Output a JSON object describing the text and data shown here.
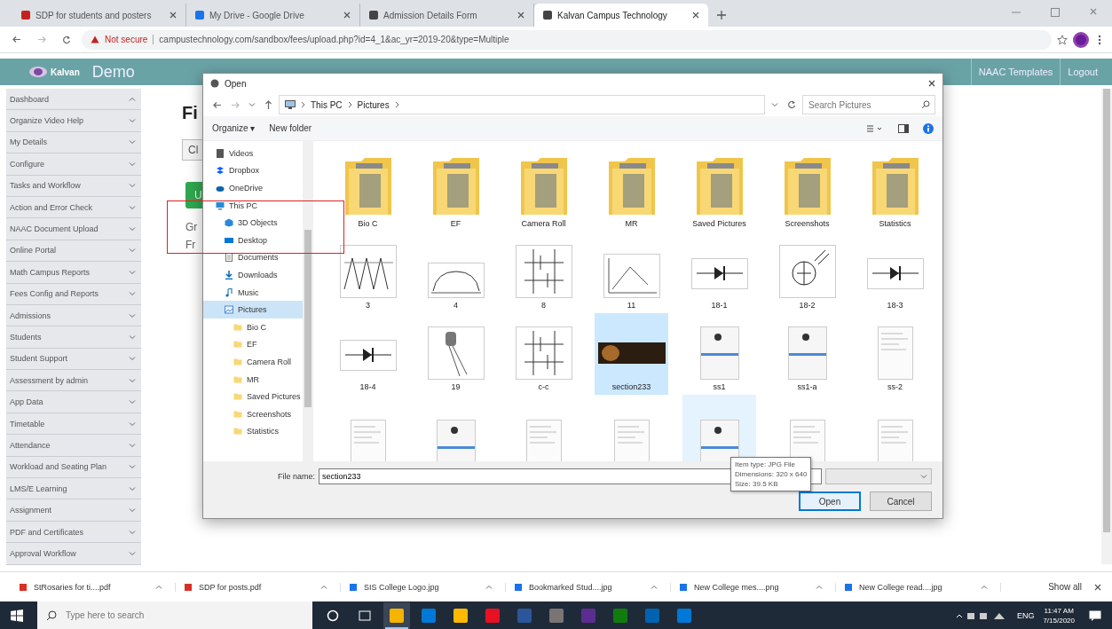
{
  "browser": {
    "tabs": [
      {
        "label": "SDP for students and posters",
        "selected": false,
        "color": "#c5221f"
      },
      {
        "label": "My Drive - Google Drive",
        "selected": false,
        "color": "#1a73e8"
      },
      {
        "label": "Admission Details Form",
        "selected": false,
        "color": "#444444"
      },
      {
        "label": "Kalvan Campus Technology",
        "selected": true,
        "color": "#444444"
      }
    ],
    "security": "Not secure",
    "url": "campustechnology.com/sandbox/fees/upload.php?id=4_1&ac_yr=2019-20&type=Multiple"
  },
  "app": {
    "logo": "Kalvan",
    "title": "Demo",
    "links": [
      "NAAC Templates",
      "Logout"
    ]
  },
  "sidebar": {
    "items": [
      {
        "label": "Dashboard",
        "expanded": true
      },
      {
        "label": "Organize Video Help",
        "expanded": false
      },
      {
        "label": "My Details",
        "expanded": false
      },
      {
        "label": "Configure",
        "expanded": false
      },
      {
        "label": "Tasks and Workflow",
        "expanded": false
      },
      {
        "label": "Action and Error Check",
        "expanded": false
      },
      {
        "label": "NAAC Document Upload",
        "expanded": false
      },
      {
        "label": "Online Portal",
        "expanded": false
      },
      {
        "label": "Math Campus Reports",
        "expanded": false
      },
      {
        "label": "Fees Config and Reports",
        "expanded": false
      },
      {
        "label": "Admissions",
        "expanded": false
      },
      {
        "label": "Students",
        "expanded": false
      },
      {
        "label": "Student Support",
        "expanded": false
      },
      {
        "label": "Assessment by admin",
        "expanded": false
      },
      {
        "label": "App Data",
        "expanded": false
      },
      {
        "label": "Timetable",
        "expanded": false
      },
      {
        "label": "Attendance",
        "expanded": false
      },
      {
        "label": "Workload and Seating Plan",
        "expanded": false
      },
      {
        "label": "LMS/E Learning",
        "expanded": false
      },
      {
        "label": "Assignment",
        "expanded": false
      },
      {
        "label": "PDF and Certificates",
        "expanded": false
      },
      {
        "label": "Approval Workflow",
        "expanded": false
      }
    ]
  },
  "content": {
    "heading": "Fi",
    "button": "Cl",
    "action": "U",
    "lines": [
      "Gr",
      "Fr"
    ]
  },
  "dialog": {
    "title": "Open",
    "path": [
      "This PC",
      "Pictures"
    ],
    "search": {
      "placeholder": "Search Pictures"
    },
    "toolbar": [
      "Organize ▾",
      "New folder"
    ],
    "nav": [
      {
        "label": "Videos",
        "kind": "video",
        "selected": false
      },
      {
        "label": "Dropbox",
        "kind": "dropbox",
        "selected": false
      },
      {
        "label": "OneDrive",
        "kind": "cloud",
        "selected": false
      },
      {
        "label": "This PC",
        "kind": "pc",
        "selected": false,
        "children": [
          {
            "label": "3D Objects",
            "kind": "cube",
            "selected": false
          },
          {
            "label": "Desktop",
            "kind": "desktop",
            "selected": false
          },
          {
            "label": "Documents",
            "kind": "document",
            "selected": false
          },
          {
            "label": "Downloads",
            "kind": "download",
            "selected": false
          },
          {
            "label": "Music",
            "kind": "music",
            "selected": false
          },
          {
            "label": "Pictures",
            "kind": "pictures",
            "selected": true,
            "children": [
              {
                "label": "Bio C",
                "kind": "folder",
                "selected": false
              },
              {
                "label": "EF",
                "kind": "folder",
                "selected": false
              },
              {
                "label": "Camera Roll",
                "kind": "folder",
                "selected": false
              },
              {
                "label": "MR",
                "kind": "folder",
                "selected": false
              },
              {
                "label": "Saved Pictures",
                "kind": "folder",
                "selected": false
              },
              {
                "label": "Screenshots",
                "kind": "folder",
                "selected": false
              },
              {
                "label": "Statistics",
                "kind": "folder",
                "selected": false
              }
            ]
          }
        ]
      }
    ],
    "items": [
      {
        "label": "Bio C",
        "kind": "folder",
        "selected": false,
        "hovered": false
      },
      {
        "label": "EF",
        "kind": "folder",
        "selected": false,
        "hovered": false
      },
      {
        "label": "Camera Roll",
        "kind": "folder",
        "selected": false,
        "hovered": false
      },
      {
        "label": "MR",
        "kind": "folder",
        "selected": false,
        "hovered": false
      },
      {
        "label": "Saved Pictures",
        "kind": "folder",
        "selected": false,
        "hovered": false
      },
      {
        "label": "Screenshots",
        "kind": "folder",
        "selected": false,
        "hovered": false
      },
      {
        "label": "Statistics",
        "kind": "folder",
        "selected": false,
        "hovered": false
      },
      {
        "label": "3",
        "kind": "waveform",
        "selected": false,
        "hovered": false
      },
      {
        "label": "4",
        "kind": "curve",
        "selected": false,
        "hovered": false
      },
      {
        "label": "8",
        "kind": "circuit",
        "selected": false,
        "hovered": false
      },
      {
        "label": "11",
        "kind": "graph",
        "selected": false,
        "hovered": false
      },
      {
        "label": "18-1",
        "kind": "diode",
        "selected": false,
        "hovered": false
      },
      {
        "label": "18-2",
        "kind": "phototube",
        "selected": false,
        "hovered": false
      },
      {
        "label": "18-3",
        "kind": "diode",
        "selected": false,
        "hovered": false
      },
      {
        "label": "18-4",
        "kind": "diode",
        "selected": false,
        "hovered": false
      },
      {
        "label": "19",
        "kind": "component",
        "selected": false,
        "hovered": false
      },
      {
        "label": "c-c",
        "kind": "circuit",
        "selected": false,
        "hovered": false
      },
      {
        "label": "section233",
        "kind": "banner",
        "selected": true,
        "hovered": false
      },
      {
        "label": "ss1",
        "kind": "screenshot",
        "selected": false,
        "hovered": false
      },
      {
        "label": "ss1-a",
        "kind": "screenshot",
        "selected": false,
        "hovered": false
      },
      {
        "label": "ss-2",
        "kind": "document",
        "selected": false,
        "hovered": false
      },
      {
        "kind": "document",
        "selected": false,
        "hovered": false
      },
      {
        "kind": "screenshot",
        "selected": false,
        "hovered": false
      },
      {
        "kind": "document",
        "selected": false,
        "hovered": false
      },
      {
        "kind": "document",
        "selected": false,
        "hovered": false
      },
      {
        "kind": "screenshot",
        "selected": false,
        "hovered": true
      },
      {
        "kind": "document",
        "selected": false,
        "hovered": false
      },
      {
        "kind": "document",
        "selected": false,
        "hovered": false
      }
    ],
    "tooltip": [
      "Item type: JPG File",
      "Dimensions: 320 x 640",
      "Size: 39.5 KB"
    ],
    "file_name_label": "File name:",
    "file_name": "section233",
    "buttons": [
      "Open",
      "Cancel"
    ]
  },
  "downloads": {
    "items": [
      {
        "name": "StRosaries for ti....pdf",
        "color": "#d93025"
      },
      {
        "name": "SDP for posts.pdf",
        "color": "#d93025"
      },
      {
        "name": "SIS College Logo.jpg",
        "color": "#1a73e8"
      },
      {
        "name": "Bookmarked Stud....jpg",
        "color": "#1a73e8"
      },
      {
        "name": "New College mes....png",
        "color": "#1a73e8"
      },
      {
        "name": "New College read....jpg",
        "color": "#1a73e8"
      }
    ],
    "show_all": "Show all"
  },
  "taskbar": {
    "search": {
      "placeholder": "Type here to search"
    },
    "apps": [
      {
        "color": "#f4b400",
        "selected": true
      },
      {
        "color": "#0078d7",
        "selected": false
      },
      {
        "color": "#ffb900",
        "selected": false
      },
      {
        "color": "#e81123",
        "selected": false
      },
      {
        "color": "#2b579a",
        "selected": false
      },
      {
        "color": "#7a7574",
        "selected": false
      },
      {
        "color": "#5c2d91",
        "selected": false
      },
      {
        "color": "#107c10",
        "selected": false
      },
      {
        "color": "#0063b1",
        "selected": false
      },
      {
        "color": "#0078d7",
        "selected": false
      }
    ],
    "language": "ENG",
    "time": "11:47 AM",
    "date": "7/15/2020"
  }
}
